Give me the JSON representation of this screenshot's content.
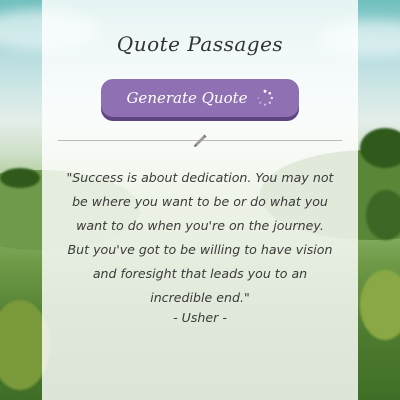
{
  "app": {
    "title": "Quote Passages"
  },
  "generate_button": {
    "label": "Generate Quote",
    "spinner_icon": "spinner-icon"
  },
  "divider": {
    "icon": "pen-icon"
  },
  "quote": {
    "text": "\"Success is about dedication. You may not be where you want to be or do what you want to do when you're on the journey. But you've got to be willing to have vision and foresight that leads you to an incredible end.\"",
    "author": "- Usher -"
  },
  "colors": {
    "button": "#8e70b3",
    "button_shadow": "#5f4683",
    "panel": "rgba(255,255,255,0.82)"
  }
}
